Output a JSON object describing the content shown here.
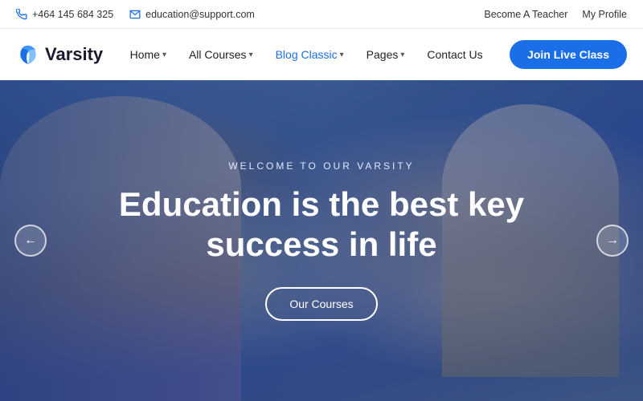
{
  "topbar": {
    "phone": "+464 145 684 325",
    "email": "education@support.com",
    "become_teacher": "Become A Teacher",
    "my_profile": "My Profile"
  },
  "navbar": {
    "logo_text": "Varsity",
    "nav_items": [
      {
        "label": "Home",
        "has_dropdown": true
      },
      {
        "label": "All Courses",
        "has_dropdown": true
      },
      {
        "label": "Blog Classic",
        "has_dropdown": true
      },
      {
        "label": "Pages",
        "has_dropdown": true
      },
      {
        "label": "Contact Us",
        "has_dropdown": false
      }
    ],
    "cta_button": "Join Live Class"
  },
  "hero": {
    "subtitle": "WELCOME TO OUR VARSITY",
    "title": "Education is the best key success in life",
    "cta_button": "Our Courses",
    "arrow_left": "←",
    "arrow_right": "→"
  },
  "colors": {
    "accent": "#1a6fe8",
    "text_dark": "#1a1a2e",
    "hero_overlay": "rgba(20,50,120,0.65)"
  }
}
